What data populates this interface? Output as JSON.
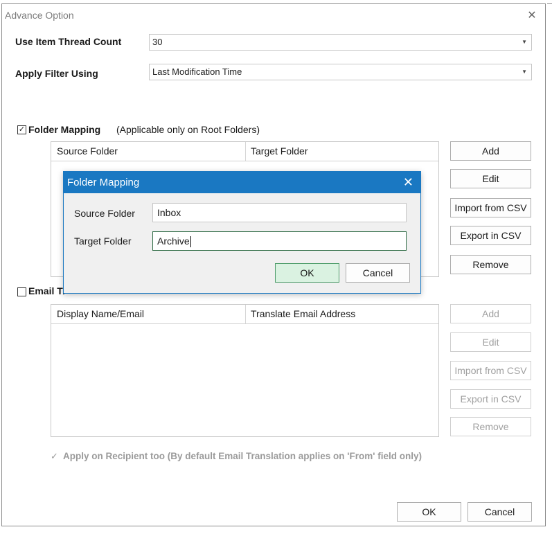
{
  "window": {
    "title": "Advance Option",
    "close_glyph": "✕"
  },
  "thread_count": {
    "label": "Use Item Thread Count",
    "value": "30"
  },
  "apply_filter": {
    "label": "Apply Filter Using",
    "value": "Last Modification Time"
  },
  "folder_mapping": {
    "checkbox_label": "Folder Mapping",
    "checked": true,
    "note": "(Applicable only on Root Folders)",
    "columns": [
      "Source Folder",
      "Target Folder"
    ],
    "buttons": [
      "Add",
      "Edit",
      "Import from CSV",
      "Export in CSV",
      "Remove"
    ]
  },
  "email_translation": {
    "checkbox_label": "Email Tr",
    "checked": false,
    "columns": [
      "Display Name/Email",
      "Translate Email Address"
    ],
    "buttons": [
      "Add",
      "Edit",
      "Import from CSV",
      "Export in CSV",
      "Remove"
    ],
    "apply_on_recipient": "Apply on Recipient too (By default Email Translation applies on 'From' field only)"
  },
  "footer": {
    "ok": "OK",
    "cancel": "Cancel"
  },
  "modal": {
    "title": "Folder Mapping",
    "close_glyph": "✕",
    "source_label": "Source Folder",
    "source_value": "Inbox",
    "target_label": "Target Folder",
    "target_value": "Archive",
    "ok": "OK",
    "cancel": "Cancel"
  },
  "colors": {
    "accent": "#1a78c2",
    "default_button": "#daf2e1"
  }
}
